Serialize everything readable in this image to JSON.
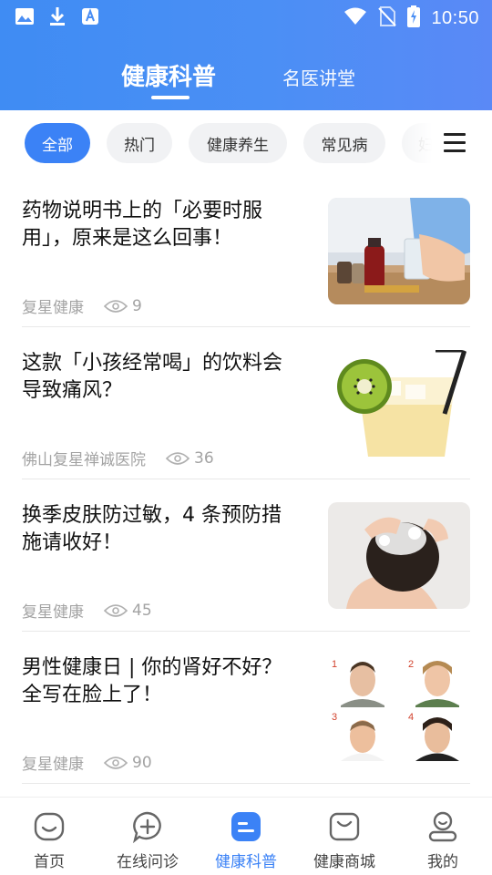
{
  "status_bar": {
    "time": "10:50",
    "left_icons": [
      "image-icon",
      "download-icon",
      "app-store-icon"
    ],
    "right_icons": [
      "wifi-icon",
      "no-sim-icon",
      "battery-charging-icon"
    ]
  },
  "header": {
    "tabs": [
      {
        "label": "健康科普",
        "active": true
      },
      {
        "label": "名医讲堂",
        "active": false
      }
    ]
  },
  "categories": {
    "items": [
      {
        "label": "全部",
        "active": true
      },
      {
        "label": "热门",
        "active": false
      },
      {
        "label": "健康养生",
        "active": false
      },
      {
        "label": "常见病",
        "active": false
      },
      {
        "label": "妇",
        "active": false
      }
    ],
    "menu_icon": "hamburger-icon"
  },
  "articles": [
    {
      "title": "药物说明书上的「必要时服用」，原来是这么回事！",
      "source": "复星健康",
      "views": "9",
      "image": "medicine-bottles-image"
    },
    {
      "title": "这款「小孩经常喝」的饮料会导致痛风？",
      "source": "佛山复星禅诚医院",
      "views": "36",
      "image": "kiwi-drink-image"
    },
    {
      "title": "换季皮肤防过敏，4 条预防措施请收好！",
      "source": "复星健康",
      "views": "45",
      "image": "hair-washing-image"
    },
    {
      "title": "男性健康日 | 你的肾好不好？全写在脸上了！",
      "source": "复星健康",
      "views": "90",
      "image": "four-faces-image"
    }
  ],
  "bottom_nav": {
    "items": [
      {
        "label": "首页",
        "icon": "home-face-icon",
        "active": false
      },
      {
        "label": "在线问诊",
        "icon": "consult-chat-icon",
        "active": false
      },
      {
        "label": "健康科普",
        "icon": "article-icon",
        "active": true
      },
      {
        "label": "健康商城",
        "icon": "shopping-bag-icon",
        "active": false
      },
      {
        "label": "我的",
        "icon": "profile-icon",
        "active": false
      }
    ]
  },
  "colors": {
    "brand_blue": "#3b82f6",
    "header_gradient_start": "#3f8cf3",
    "header_gradient_end": "#5a89f6",
    "muted_text": "#a3a3a3"
  }
}
